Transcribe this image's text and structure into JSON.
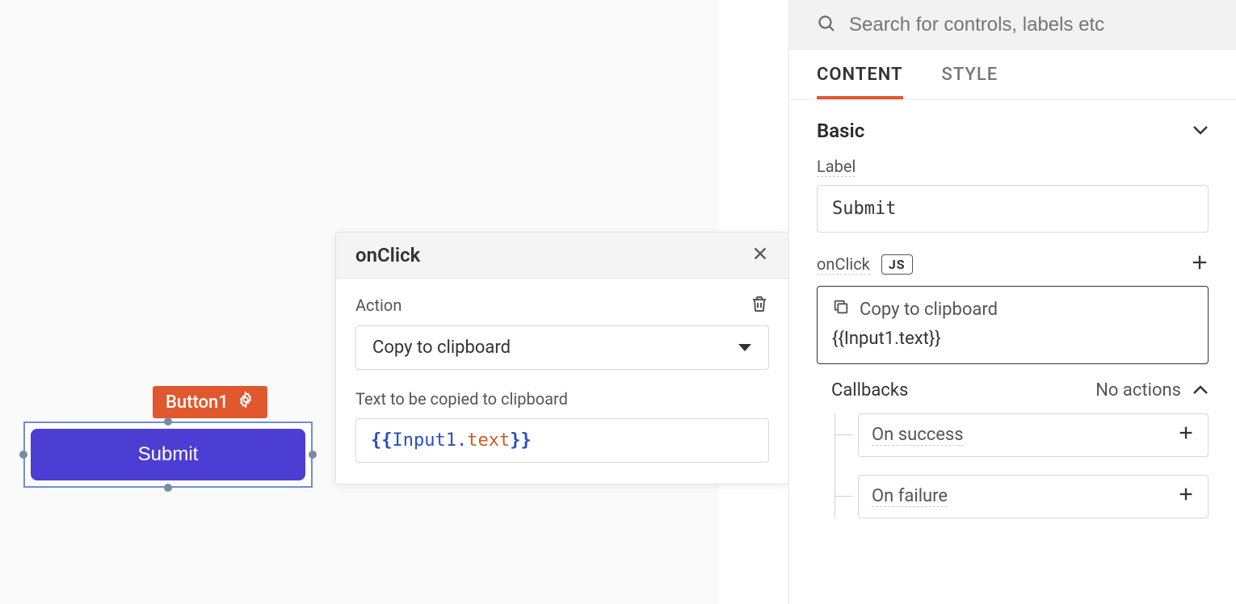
{
  "canvas": {
    "widget_tag": "Button1",
    "button_label": "Submit"
  },
  "popup": {
    "title": "onClick",
    "action_label": "Action",
    "action_value": "Copy to clipboard",
    "text_label": "Text to be copied to clipboard",
    "expr_open": "{{",
    "expr_obj": "Input1",
    "expr_dot": ".",
    "expr_prop": "text",
    "expr_close": "}}"
  },
  "panel": {
    "search_placeholder": "Search for controls, labels etc",
    "tabs": {
      "content": "CONTENT",
      "style": "STYLE"
    },
    "section_basic": "Basic",
    "label_field": "Label",
    "label_value": "Submit",
    "onclick_field": "onClick",
    "js_badge": "JS",
    "action_summary": "Copy to clipboard",
    "action_expr": "{{Input1.text}}",
    "callbacks_label": "Callbacks",
    "callbacks_summary": "No actions",
    "on_success": "On success",
    "on_failure": "On failure"
  }
}
